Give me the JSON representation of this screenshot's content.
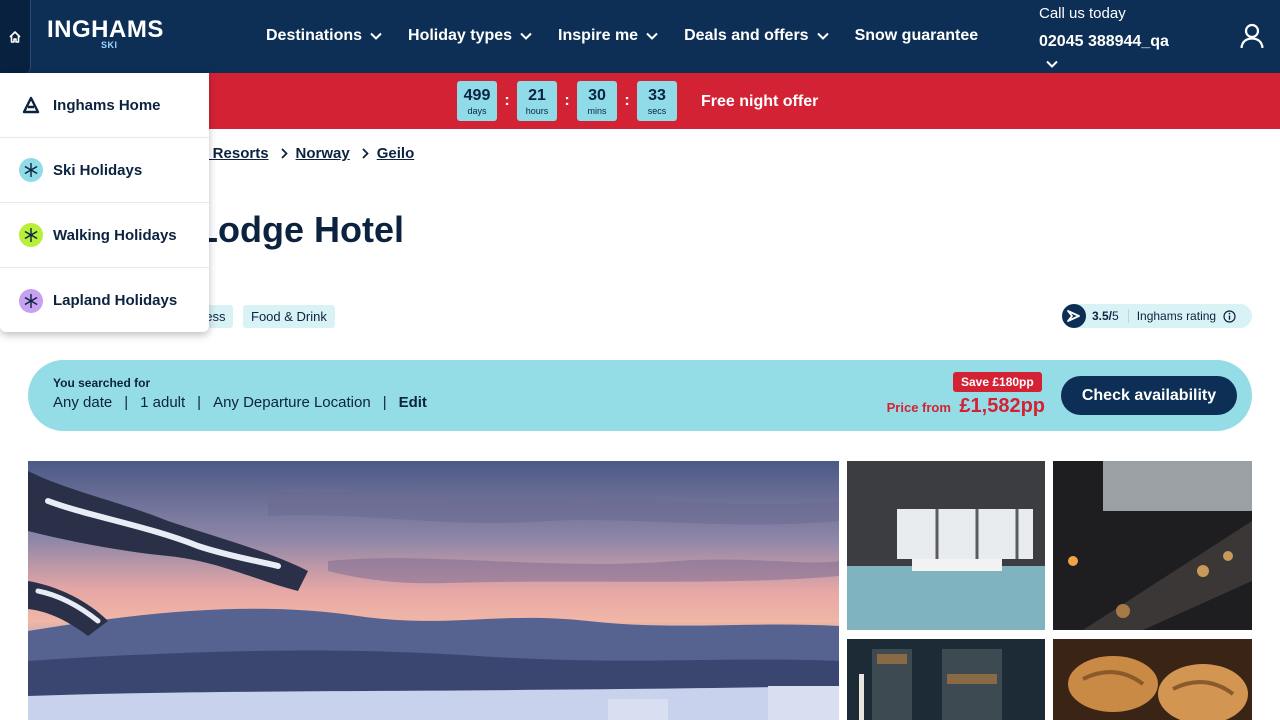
{
  "header": {
    "brand": "INGHAMS",
    "brand_sub": "SKI",
    "nav": [
      {
        "label": "Destinations"
      },
      {
        "label": "Holiday types"
      },
      {
        "label": "Inspire me"
      },
      {
        "label": "Deals and offers"
      },
      {
        "label": "Snow guarantee"
      }
    ],
    "call_label": "Call us today",
    "phone": "02045 388944_qa"
  },
  "countdown": {
    "days": {
      "value": "499",
      "unit": "days"
    },
    "hours": {
      "value": "21",
      "unit": "hours"
    },
    "mins": {
      "value": "30",
      "unit": "mins"
    },
    "secs": {
      "value": "33",
      "unit": "secs"
    },
    "separator": ":",
    "offer": "Free night offer"
  },
  "breadcrumb": {
    "items": [
      "ki Resorts",
      "Norway",
      "Geilo"
    ]
  },
  "page_title": "Lodge Hotel",
  "tags": [
    "ness",
    "Food & Drink"
  ],
  "rating": {
    "score": "3.5/",
    "max": "5",
    "label": "Inghams rating"
  },
  "search": {
    "label": "You searched for",
    "date": "Any date",
    "adults": "1 adult",
    "departure": "Any Departure Location",
    "edit": "Edit",
    "save": "Save £180pp",
    "price_from": "Price from",
    "price": "£1,582pp",
    "cta": "Check availability"
  },
  "site_switcher": {
    "items": [
      {
        "label": "Inghams Home",
        "icon": "inghams-logo-icon"
      },
      {
        "label": "Ski Holidays",
        "icon": "snowflake-icon"
      },
      {
        "label": "Walking Holidays",
        "icon": "hiking-icon"
      },
      {
        "label": "Lapland Holidays",
        "icon": "lapland-icon"
      }
    ]
  },
  "colors": {
    "navy": "#0d2f55",
    "red": "#d42235",
    "aqua": "#95dde6"
  }
}
